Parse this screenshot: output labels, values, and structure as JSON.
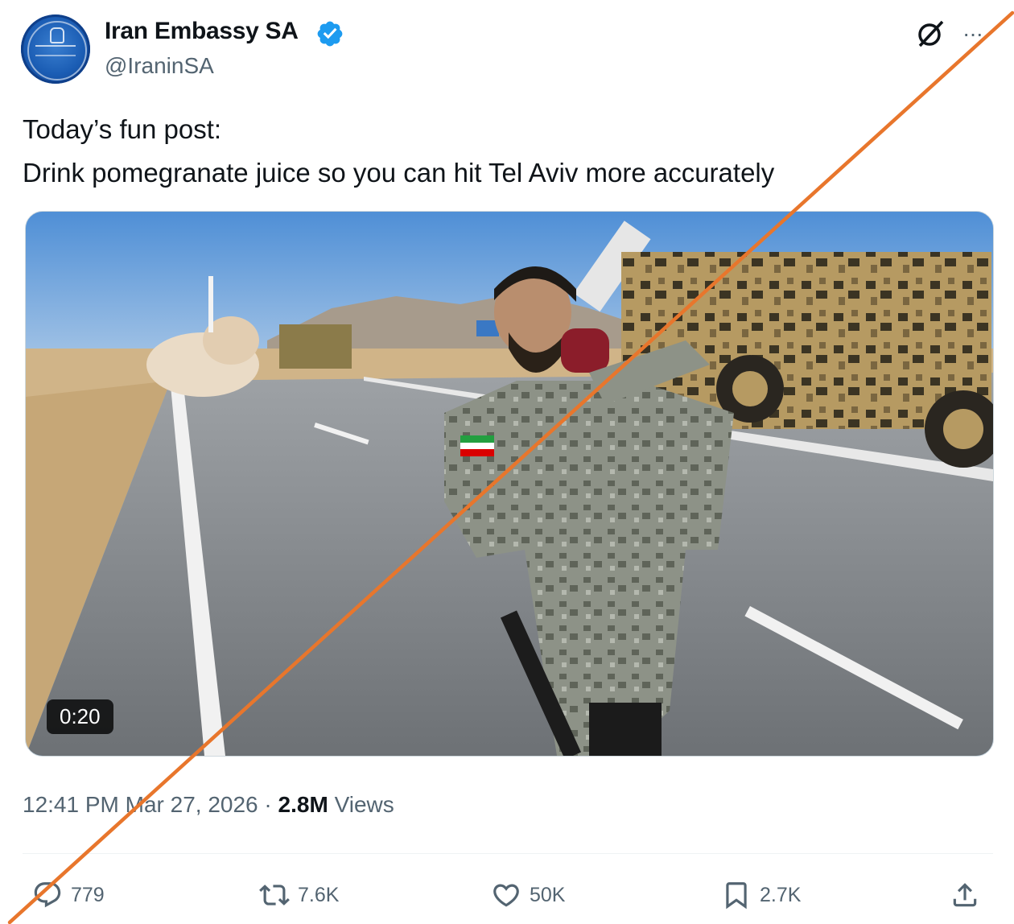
{
  "author": {
    "name": "Iran Embassy SA",
    "handle": "@IraninSA",
    "avatar_icon": "embassy-emblem-icon",
    "verified_icon": "verified-badge-icon",
    "verified_color": "#1d9bf0"
  },
  "header_icons": [
    "grok-icon",
    "more-icon"
  ],
  "more_label": "···",
  "post": {
    "line1": "Today’s fun post:",
    "line2": "Drink pomegranate juice so you can hit Tel Aviv more accurately"
  },
  "media": {
    "type": "video",
    "duration": "0:20"
  },
  "meta": {
    "time": "12:41 PM",
    "date": "Mar 27, 2026",
    "separator": "·",
    "views_count": "2.8M",
    "views_label": "Views"
  },
  "actions": {
    "replies": "779",
    "reposts": "7.6K",
    "likes": "50K",
    "bookmarks": "2.7K"
  },
  "colors": {
    "text": "#0f1419",
    "secondary": "#536471",
    "strike_line": "#e8762c"
  }
}
